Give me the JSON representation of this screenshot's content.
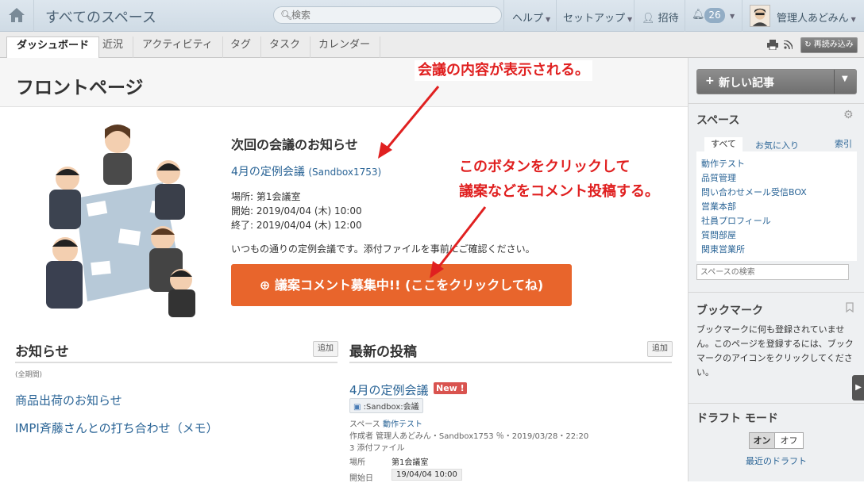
{
  "topbar": {
    "space_title": "すべてのスペース",
    "search_placeholder": "検索",
    "help": "ヘルプ",
    "setup": "セットアップ",
    "invite": "招待",
    "notification_count": "26",
    "user": "管理人あどみん"
  },
  "tabs": [
    "ダッシュボード",
    "近況",
    "アクティビティ",
    "タグ",
    "タスク",
    "カレンダー"
  ],
  "reload_label": "再読み込み",
  "page_title": "フロントページ",
  "meeting": {
    "heading": "次回の会議のお知らせ",
    "title": "4月の定例会議",
    "space": "(Sandbox1753)",
    "place": "場所: 第1会議室",
    "start": "開始: 2019/04/04 (木) 10:00",
    "end": "終了: 2019/04/04 (木) 12:00",
    "note": "いつもの通りの定例会議です。添付ファイルを事前にご確認ください。",
    "cta": "議案コメント募集中!! (ここをクリックしてね)"
  },
  "annotations": {
    "top": "会議の内容が表示される。",
    "button_line1": "このボタンをクリックして",
    "button_line2": "議案などをコメント投稿する。"
  },
  "news": {
    "heading": "お知らせ",
    "add": "追加",
    "period": "(全期間)",
    "items": [
      "商品出荷のお知らせ",
      "IMPI斉藤さんとの打ち合わせ（メモ）"
    ]
  },
  "recent": {
    "heading": "最新の投稿",
    "add": "追加",
    "title": "4月の定例会議",
    "new_badge": "New !",
    "tag": ":Sandbox:会議",
    "space_label": "スペース",
    "space_value": "動作テスト",
    "author": "作成者 管理人あどみん・Sandbox1753 ％・2019/03/28・22:20",
    "attachments": "3 添付ファイル",
    "place_label": "場所",
    "place_value": "第1会議室",
    "date_label": "開始日",
    "date_value": "19/04/04 10:00"
  },
  "sidebar": {
    "new_article": "新しい記事",
    "spaces_heading": "スペース",
    "tab_all": "すべて",
    "tab_fav": "お気に入り",
    "index": "索引",
    "spaces": [
      "動作テスト",
      "品質管理",
      "問い合わせメール受信BOX",
      "営業本部",
      "社員プロフィール",
      "質問部屋",
      "関東営業所"
    ],
    "space_search_placeholder": "スペースの検索",
    "bookmark_heading": "ブックマーク",
    "bookmark_text": "ブックマークに何も登録されていません。このページを登録するには、ブックマークのアイコンをクリックしてください。",
    "draft_heading": "ドラフト モード",
    "draft_on": "オン",
    "draft_off": "オフ",
    "recent_drafts": "最近のドラフト"
  }
}
